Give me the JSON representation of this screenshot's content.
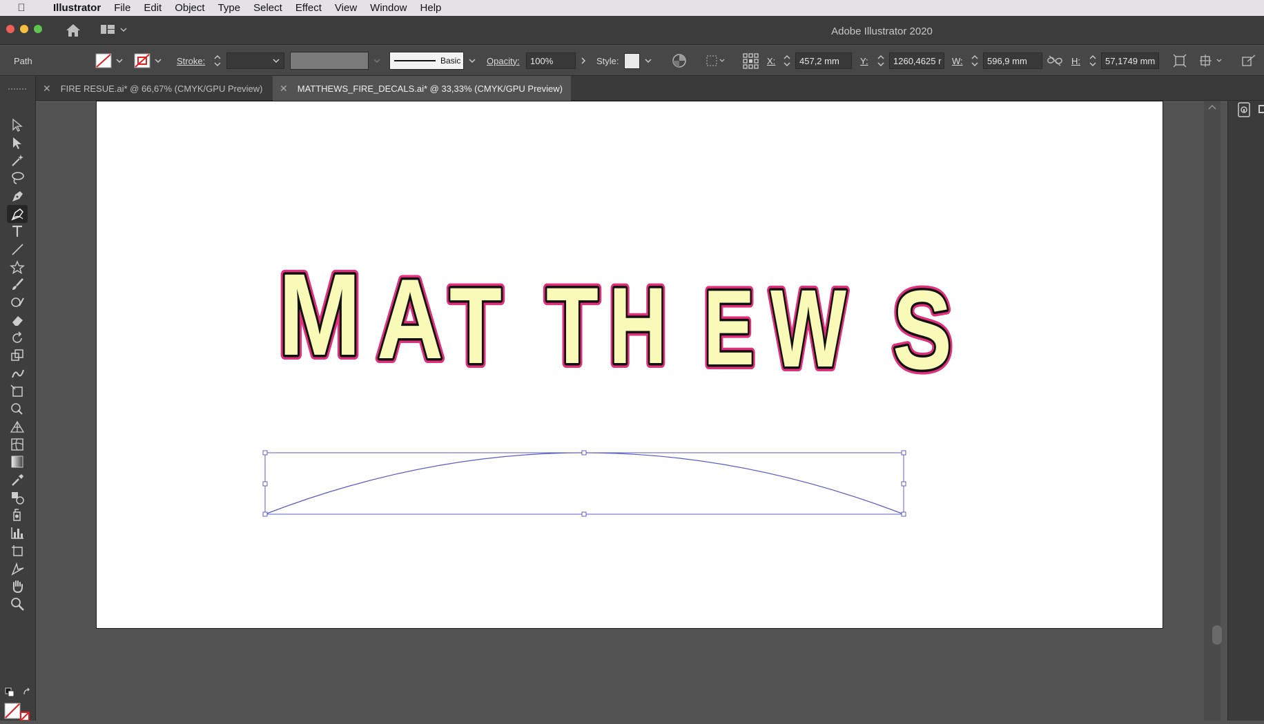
{
  "menubar": {
    "app_name": "Illustrator",
    "items": [
      "File",
      "Edit",
      "Object",
      "Type",
      "Select",
      "Effect",
      "View",
      "Window",
      "Help"
    ]
  },
  "window": {
    "title": "Adobe Illustrator 2020"
  },
  "control": {
    "selection_type": "Path",
    "stroke_label": "Stroke:",
    "brush_label": "Basic",
    "opacity_label": "Opacity:",
    "opacity_value": "100%",
    "style_label": "Style:",
    "x_label": "X:",
    "x_value": "457,2 mm",
    "y_label": "Y:",
    "y_value": "1260,4625 r",
    "w_label": "W:",
    "w_value": "596,9 mm",
    "h_label": "H:",
    "h_value": "57,1749 mm"
  },
  "tabs": [
    {
      "label": "FIRE RESUE.ai* @ 66,67% (CMYK/GPU Preview)",
      "active": false
    },
    {
      "label": "MATTHEWS_FIRE_DECALS.ai* @ 33,33% (CMYK/GPU Preview)",
      "active": true
    }
  ],
  "artwork": {
    "letters": [
      "M",
      "A",
      "T",
      "T",
      "H",
      "E",
      "W",
      "S"
    ],
    "fill_color": "#fafab8",
    "inner_stroke_color": "#111111",
    "outer_stroke_color": "#e0317a",
    "path_color": "#5c5cc8"
  },
  "tools": [
    "selection-icon",
    "direct-selection-icon",
    "magic-wand-icon",
    "lasso-icon",
    "pen-icon",
    "curvature-icon",
    "type-icon",
    "line-segment-icon",
    "star-icon",
    "paintbrush-icon",
    "shaper-icon",
    "eraser-icon",
    "rotate-icon",
    "scale-icon",
    "warp-icon",
    "free-transform-icon",
    "shape-builder-icon",
    "perspective-grid-icon",
    "mesh-icon",
    "gradient-icon",
    "eyedropper-icon",
    "blend-icon",
    "symbol-sprayer-icon",
    "graph-icon",
    "artboard-icon",
    "slice-icon",
    "hand-icon",
    "zoom-icon"
  ]
}
